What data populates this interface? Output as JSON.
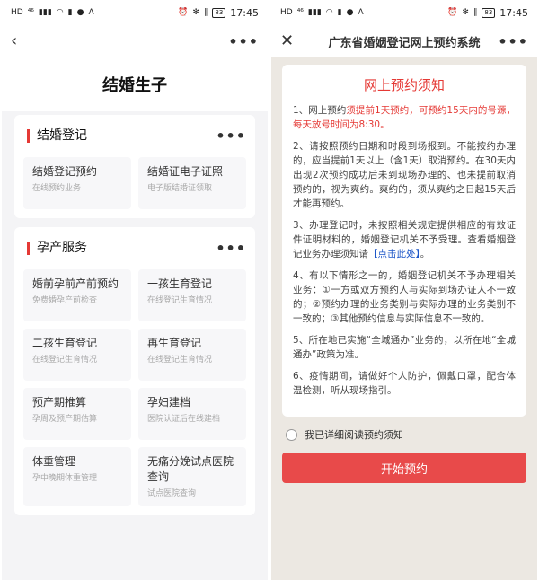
{
  "status_bar": {
    "left_glyphs": [
      "HD",
      "⁴⁶",
      "▮▮▮",
      "◠",
      "▮",
      "●",
      "ᐱ"
    ],
    "right_glyphs": [
      "⏰",
      "✻",
      "∥"
    ],
    "battery": "83",
    "time": "17:45"
  },
  "left": {
    "page_title": "结婚生子",
    "sections": [
      {
        "title": "结婚登记",
        "tiles": [
          {
            "title": "结婚登记预约",
            "sub": "在线预约业务"
          },
          {
            "title": "结婚证电子证照",
            "sub": "电子版结婚证领取"
          }
        ]
      },
      {
        "title": "孕产服务",
        "tiles": [
          {
            "title": "婚前孕前产前预约",
            "sub": "免费婚孕产前检查"
          },
          {
            "title": "一孩生育登记",
            "sub": "在线登记生育情况"
          },
          {
            "title": "二孩生育登记",
            "sub": "在线登记生育情况"
          },
          {
            "title": "再生育登记",
            "sub": "在线登记生育情况"
          },
          {
            "title": "预产期推算",
            "sub": "孕周及预产期估算"
          },
          {
            "title": "孕妇建档",
            "sub": "医院认证后在线建档"
          },
          {
            "title": "体重管理",
            "sub": "孕中晚期体重管理"
          },
          {
            "title": "无痛分娩试点医院查询",
            "sub": "试点医院查询"
          }
        ]
      }
    ]
  },
  "right": {
    "nav_title": "广东省婚姻登记网上预约系统",
    "notice_title": "网上预约须知",
    "p1_prefix": "1、网上预约",
    "p1_red": "须提前1天预约，可预约15天内的号源，每天放号时间为8:30。",
    "p2": "2、请按照预约日期和时段到场报到。不能按约办理的，应当提前1天以上（含1天）取消预约。在30天内出现2次预约成功后未到现场办理的、也未提前取消预约的，视为爽约。爽约的，须从爽约之日起15天后才能再预约。",
    "p3": "3、办理登记时，未按照相关规定提供相应的有效证件证明材料的，婚姻登记机关不予受理。查看婚姻登记业务办理须知请",
    "p3_link": "【点击此处】",
    "p3_end": "。",
    "p4": "4、有以下情形之一的，婚姻登记机关不予办理相关业务：①一方或双方预约人与实际到场办证人不一致的；②预约办理的业务类别与实际办理的业务类别不一致的；③其他预约信息与实际信息不一致的。",
    "p5": "5、所在地已实施“全城通办”业务的，以所在地“全城通办”政策为准。",
    "p6": "6、疫情期间，请做好个人防护，佩戴口罩，配合体温检测，听从现场指引。",
    "agree_label": "我已详细阅读预约须知",
    "start_button": "开始预约"
  }
}
